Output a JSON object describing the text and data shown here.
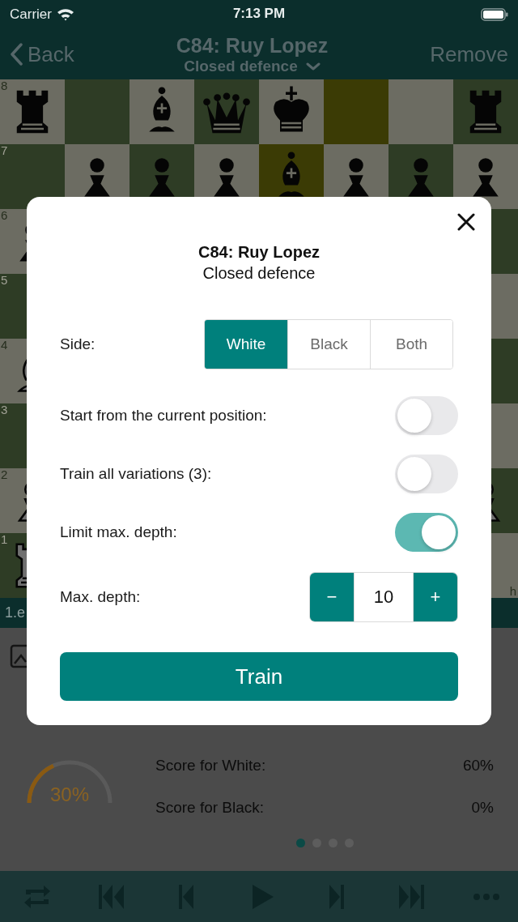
{
  "status_bar": {
    "carrier": "Carrier",
    "time": "7:13 PM"
  },
  "nav": {
    "back": "Back",
    "title": "C84: Ruy Lopez",
    "subtitle": "Closed defence",
    "action": "Remove"
  },
  "board": {
    "ranks": [
      {
        "label": "8",
        "squares": [
          {
            "piece": {
              "kind": "rook",
              "white": false
            },
            "highlight": false
          },
          {
            "highlight": false
          },
          {
            "piece": {
              "kind": "bishop",
              "white": false
            },
            "highlight": false
          },
          {
            "piece": {
              "kind": "queen",
              "white": false
            },
            "highlight": false
          },
          {
            "piece": {
              "kind": "king",
              "white": false
            },
            "highlight": false
          },
          {
            "highlight": true
          },
          {
            "highlight": false
          },
          {
            "piece": {
              "kind": "rook",
              "white": false
            },
            "highlight": false
          }
        ]
      },
      {
        "label": "7",
        "squares": [
          {
            "highlight": false
          },
          {
            "piece": {
              "kind": "pawn",
              "white": false
            },
            "highlight": false
          },
          {
            "piece": {
              "kind": "pawn",
              "white": false
            },
            "highlight": false
          },
          {
            "piece": {
              "kind": "pawn",
              "white": false
            },
            "highlight": false
          },
          {
            "piece": {
              "kind": "bishop",
              "white": false
            },
            "highlight": true
          },
          {
            "piece": {
              "kind": "pawn",
              "white": false
            },
            "highlight": false
          },
          {
            "piece": {
              "kind": "pawn",
              "white": false
            },
            "highlight": false
          },
          {
            "piece": {
              "kind": "pawn",
              "white": false
            },
            "highlight": false
          }
        ]
      },
      {
        "label": "6",
        "left": {
          "kind": "pawn",
          "white": false
        }
      },
      {
        "label": "5"
      },
      {
        "label": "4",
        "left": {
          "kind": "bishop",
          "white": true
        }
      },
      {
        "label": "3"
      },
      {
        "label": "2",
        "left": {
          "kind": "pawn",
          "white": true
        },
        "right": {
          "kind": "pawn",
          "white": true
        }
      },
      {
        "label": "1",
        "left": {
          "kind": "rook",
          "white": true
        }
      }
    ],
    "file_label": "h"
  },
  "move_bar": {
    "moves": "1.e"
  },
  "stats": {
    "gauge": {
      "level": 0.3,
      "reading": "30%"
    },
    "rows": [
      {
        "label": "Score for White:",
        "value": "60%"
      },
      {
        "label": "Score for Black:",
        "value": "0%"
      }
    ],
    "pages": [
      {
        "selected": true
      },
      {
        "selected": false
      },
      {
        "selected": false
      },
      {
        "selected": false
      }
    ]
  },
  "dialog": {
    "title": "C84: Ruy Lopez",
    "subtitle": "Closed defence",
    "side": {
      "label": "Side:",
      "options": [
        {
          "label": "White",
          "selected": true
        },
        {
          "label": "Black",
          "selected": false
        },
        {
          "label": "Both",
          "selected": false
        }
      ]
    },
    "toggles": [
      {
        "label": "Start from the current position:",
        "on": false
      },
      {
        "label": "Train all variations (3):",
        "on": false
      },
      {
        "label": "Limit max. depth:",
        "on": true
      }
    ],
    "depth": {
      "label": "Max. depth:",
      "minus": "−",
      "value": "10",
      "plus": "+"
    },
    "train": "Train"
  }
}
